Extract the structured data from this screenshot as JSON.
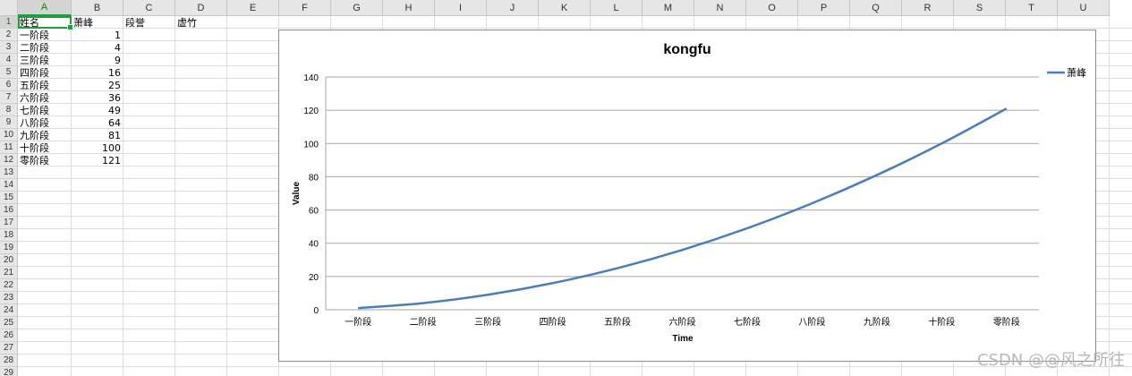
{
  "sheet": {
    "columns": [
      "A",
      "B",
      "C",
      "D",
      "E",
      "F",
      "G",
      "H",
      "I",
      "J",
      "K",
      "L",
      "M",
      "N",
      "O",
      "P",
      "Q",
      "R",
      "S",
      "T",
      "U"
    ],
    "rows": [
      "1",
      "2",
      "3",
      "4",
      "5",
      "6",
      "7",
      "8",
      "9",
      "10",
      "11",
      "12",
      "13",
      "14",
      "15",
      "16",
      "17",
      "18",
      "19",
      "20",
      "21",
      "22",
      "23",
      "24",
      "25",
      "26",
      "27",
      "28",
      "29"
    ],
    "active_column": "A",
    "active_row": "1",
    "header_row": [
      "姓名",
      "萧峰",
      "段誉",
      "虚竹"
    ],
    "data_rows": [
      {
        "label": "一阶段",
        "value": "1"
      },
      {
        "label": "二阶段",
        "value": "4"
      },
      {
        "label": "三阶段",
        "value": "9"
      },
      {
        "label": "四阶段",
        "value": "16"
      },
      {
        "label": "五阶段",
        "value": "25"
      },
      {
        "label": "六阶段",
        "value": "36"
      },
      {
        "label": "七阶段",
        "value": "49"
      },
      {
        "label": "八阶段",
        "value": "64"
      },
      {
        "label": "九阶段",
        "value": "81"
      },
      {
        "label": "十阶段",
        "value": "100"
      },
      {
        "label": "零阶段",
        "value": "121"
      }
    ]
  },
  "chart_data": {
    "type": "line",
    "title": "kongfu",
    "xlabel": "Time",
    "ylabel": "Value",
    "categories": [
      "一阶段",
      "二阶段",
      "三阶段",
      "四阶段",
      "五阶段",
      "六阶段",
      "七阶段",
      "八阶段",
      "九阶段",
      "十阶段",
      "零阶段"
    ],
    "series": [
      {
        "name": "萧峰",
        "values": [
          1,
          4,
          9,
          16,
          25,
          36,
          49,
          64,
          81,
          100,
          121
        ],
        "color": "#4a7ebb"
      }
    ],
    "ylim": [
      0,
      140
    ],
    "yticks": [
      0,
      20,
      40,
      60,
      80,
      100,
      120,
      140
    ],
    "grid": true,
    "smooth": true,
    "legend_position": "right"
  },
  "watermark": "CSDN @@风之所往",
  "colors": {
    "series": "#4a7ebb",
    "selection": "#1e9e3e",
    "header_bg": "#e6e6e6"
  }
}
